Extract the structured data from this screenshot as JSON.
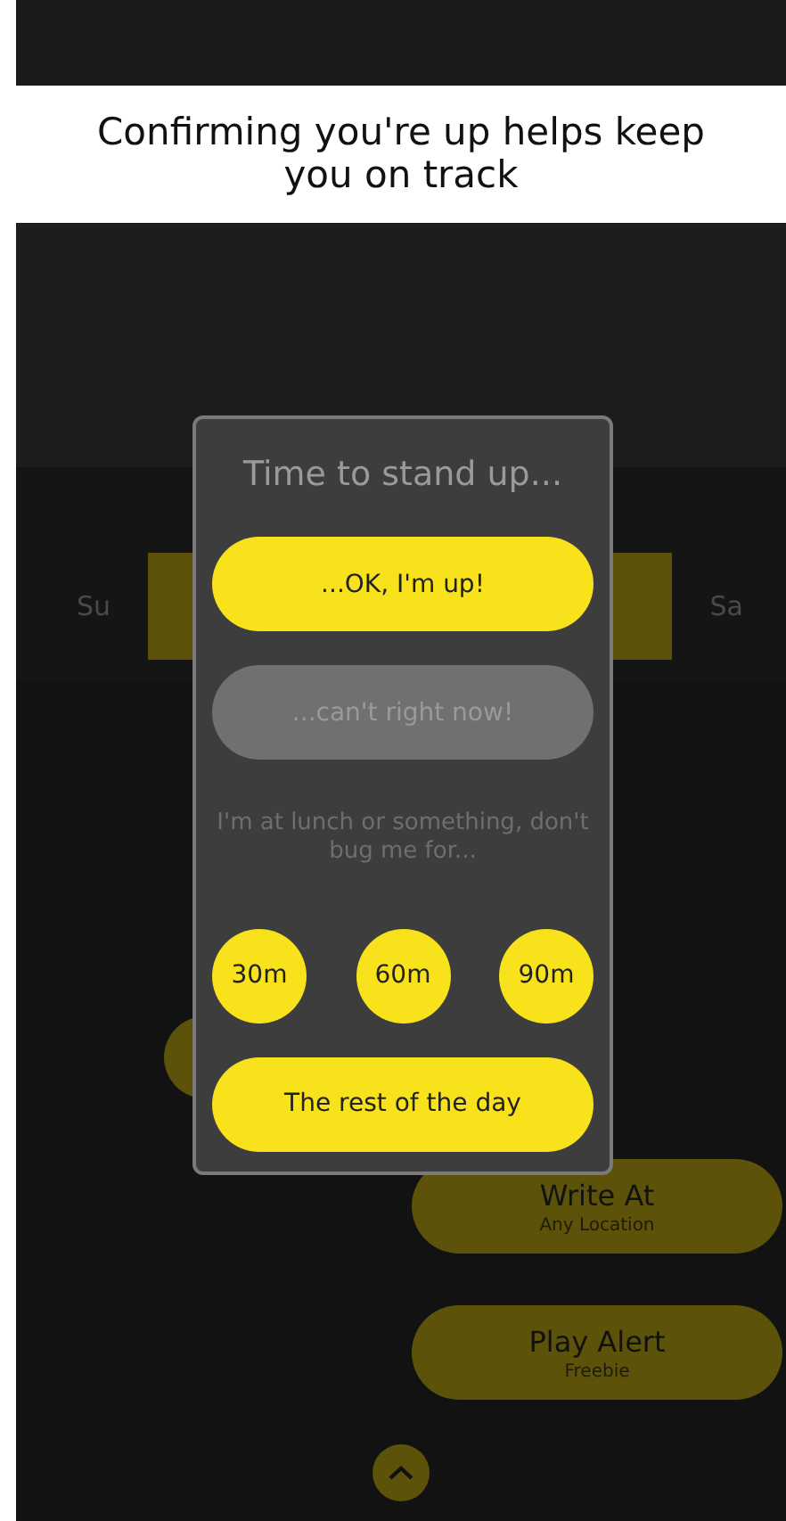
{
  "banner": {
    "text": "Confirming you're up helps keep you on track"
  },
  "days": [
    {
      "label": "Su",
      "selected": false
    },
    {
      "label": "Sa",
      "selected": false
    }
  ],
  "actions": [
    {
      "title": "Write At",
      "subtitle": "Any Location"
    },
    {
      "title": "Play Alert",
      "subtitle": "Freebie"
    }
  ],
  "dialog": {
    "title": "Time to stand up...",
    "confirm": "...OK, I'm up!",
    "decline": {
      "label": "...can't right now!",
      "disabled": true
    },
    "message": "I'm at lunch or something, don't bug me for...",
    "snooze": [
      "30m",
      "60m",
      "90m"
    ],
    "rest_of_day": "The rest of the day"
  }
}
